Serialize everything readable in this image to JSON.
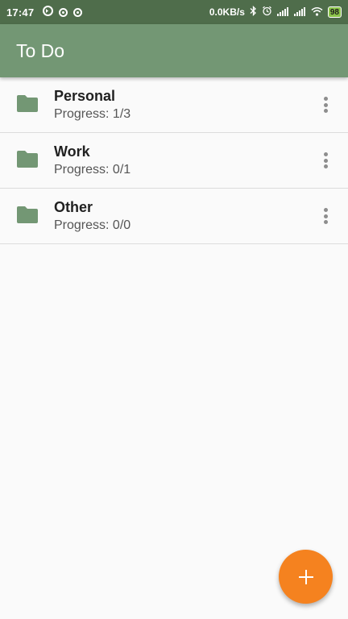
{
  "status_bar": {
    "time": "17:47",
    "network_speed": "0.0KB/s",
    "battery_level": "98",
    "icons": [
      "notification-app-icon",
      "notification-circle-icon",
      "notification-circle-icon",
      "bluetooth-icon",
      "alarm-icon",
      "signal-icon",
      "signal-icon",
      "wifi-icon",
      "battery-icon"
    ]
  },
  "app_bar": {
    "title": "To Do"
  },
  "categories": [
    {
      "title": "Personal",
      "progress": "Progress: 1/3"
    },
    {
      "title": "Work",
      "progress": "Progress: 0/1"
    },
    {
      "title": "Other",
      "progress": "Progress: 0/0"
    }
  ],
  "icons": {
    "category": "folder-icon",
    "options": "more-vert-icon",
    "fab": "add-icon"
  },
  "colors": {
    "status_bar": "#4f6d4b",
    "app_bar": "#739774",
    "folder": "#739774",
    "fab": "#f5821f",
    "background": "#fafafa"
  }
}
